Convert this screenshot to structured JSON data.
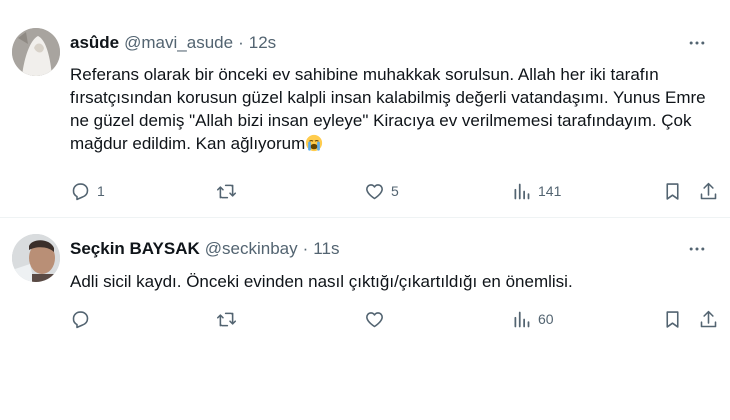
{
  "tweets": [
    {
      "author": {
        "name": "asûde",
        "handle": "@mavi_asude",
        "time": "12s",
        "avatar_icon": "avatar-photo"
      },
      "text": "Referans olarak bir önceki ev sahibine muhakkak sorulsun. Allah her iki tarafın fırsatçısından korusun güzel kalpli insan kalabilmiş değerli vatandaşımı. Yunus Emre ne güzel demiş \"Allah bizi insan eyleye\" Kiracıya ev verilmemesi tarafındayım. Çok mağdur edildim. Kan ağlıyorum",
      "emoji": "loudly-crying-face",
      "counts": {
        "replies": "1",
        "reposts": "",
        "likes": "5",
        "views": "141"
      }
    },
    {
      "author": {
        "name": "Seçkin BAYSAK",
        "handle": "@seckinbay",
        "time": "11s",
        "avatar_icon": "avatar-photo"
      },
      "text": "Adli sicil kaydı. Önceki evinden nasıl çıktığı/çıkartıldığı en önemlisi.",
      "counts": {
        "replies": "",
        "reposts": "",
        "likes": "",
        "views": "60"
      }
    }
  ],
  "separator": "·",
  "colors": {
    "text": "#0f1419",
    "secondary": "#536471",
    "border": "#eff3f4",
    "background": "#ffffff"
  }
}
